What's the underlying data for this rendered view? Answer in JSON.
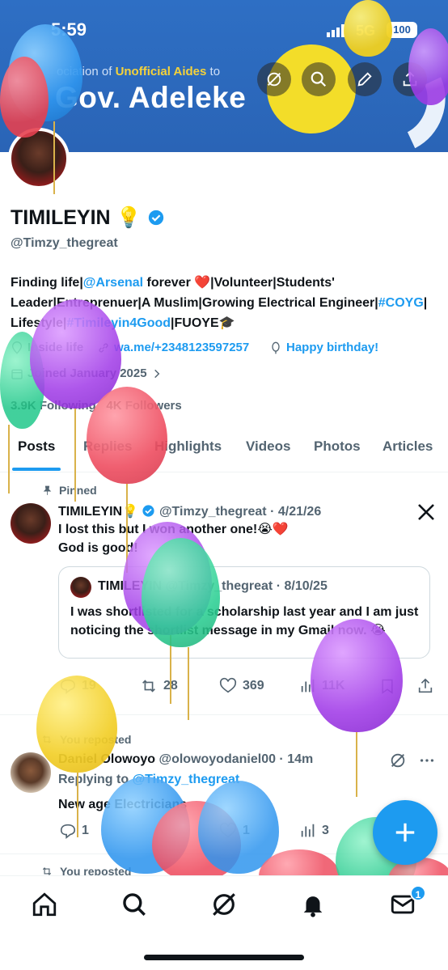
{
  "status": {
    "time": "5:59",
    "network": "5G",
    "battery": "100"
  },
  "banner": {
    "line1_pre": "ociation of",
    "line1_highlight": "Unofficial Aides",
    "line1_post": "to",
    "line2": "Gov. Adeleke"
  },
  "profile": {
    "name": "TIMILEYIN",
    "name_emoji": "💡",
    "handle": "@Timzy_thegreat",
    "bio": {
      "p1": "Finding life|",
      "p2": "@Arsenal",
      "p3": " forever ❤️|Volunteer|Students' Leader|Entreprenuer|A Muslim|Growing Electrical Engineer|",
      "p4": "#COYG",
      "p5": "| Lifestyle|",
      "p6": "#Timileyin4Good",
      "p7": "|FUOYE🎓"
    },
    "location": "Inside life",
    "link": "wa.me/+2348123597257",
    "birthday": "Happy birthday!",
    "joined": "Joined January 2025",
    "following_count": "3.9K",
    "following_label": "Following",
    "followers_count": "4K",
    "followers_label": "Followers"
  },
  "tabs": [
    "Posts",
    "Replies",
    "Highlights",
    "Videos",
    "Photos",
    "Articles"
  ],
  "pinned": {
    "label": "Pinned",
    "name": "TIMILEYIN",
    "emoji": "💡",
    "handle": "@Timzy_thegreat",
    "date": "4/21/26",
    "text1": "I lost this but I won another one!😭❤️",
    "text2": "God is good!",
    "quote": {
      "name": "TIMILEYIN",
      "handle": "@Timzy_thegreat",
      "date": "8/10/25",
      "text": "I was shortlisted for a scholarship last year and I am just noticing the shortlist message in my Gmail now. 😭"
    },
    "replies": "19",
    "reposts": "28",
    "likes": "369",
    "views": "11K"
  },
  "repost1": {
    "label": "You reposted",
    "name": "Daniel Olowoyo",
    "handle": "@olowoyodaniel00",
    "time": "14m",
    "replying_prefix": "Replying to",
    "replying_handle": "@Timzy_thegreat",
    "text": "New age Electricians",
    "replies": "1",
    "likes": "1",
    "views": "3"
  },
  "repost2": {
    "label": "You reposted"
  },
  "nav": {
    "badge": "1"
  },
  "icons": [
    "search-icon",
    "edit-icon",
    "share-icon",
    "verified-icon",
    "location-icon",
    "link-icon",
    "balloon-icon",
    "calendar-icon",
    "chevron-right-icon",
    "pin-icon",
    "x-logo-icon",
    "reply-icon",
    "repost-icon",
    "like-icon",
    "views-icon",
    "bookmark-icon",
    "grok-icon",
    "more-icon",
    "plus-icon",
    "home-icon",
    "bell-icon",
    "mail-icon"
  ],
  "colors": {
    "accent": "#1d9bf0",
    "banner": "#2e6fc4",
    "text": "#0f1419",
    "muted": "#536471"
  }
}
